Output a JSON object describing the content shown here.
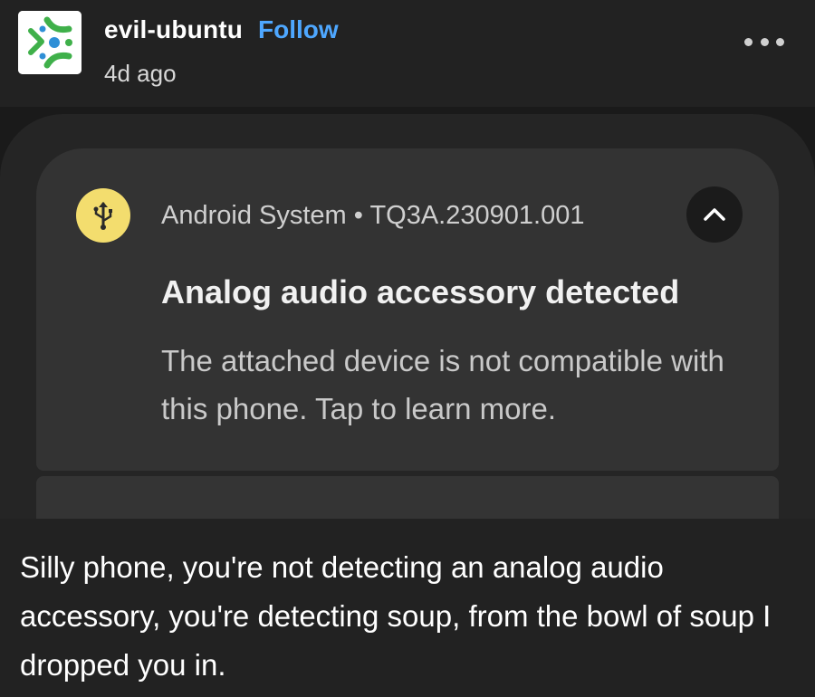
{
  "post": {
    "username": "evil-ubuntu",
    "follow_label": "Follow",
    "time": "4d ago",
    "more_icon": "ellipsis-icon",
    "caption": "Silly phone, you're not detecting an analog audio accessory, you're detecting soup, from the bowl of soup I dropped you in."
  },
  "notification": {
    "app_icon": "usb-icon",
    "source": "Android System • TQ3A.230901.001",
    "collapse_icon": "chevron-up-icon",
    "title": "Analog audio accessory detected",
    "body": "The attached device is not compatible with this phone. Tap to learn more."
  },
  "colors": {
    "background": "#222222",
    "link": "#4ea7ff",
    "notification_card": "#333333",
    "app_icon_bg": "#f3dd6e"
  }
}
